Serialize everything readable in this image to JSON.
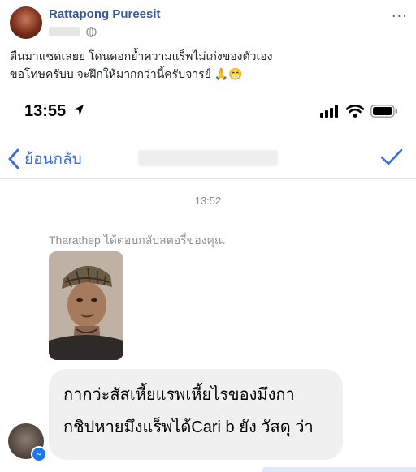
{
  "post": {
    "author": "Rattapong Pureesit",
    "more_glyph": "···",
    "caption_line1": "ตื่นมาแซดเลยย โดนดอกย้ำความแร็พไม่เก่งของตัวเอง",
    "caption_line2": "ขอโทษครับบ จะฝึกให้มากกว่านี้ครับจารย์ 🙏😁"
  },
  "phone": {
    "status_time": "13:55",
    "nav_back_label": "ย้อนกลับ",
    "timestamp": "13:52",
    "story_reply_note": "Tharathep ได้ตอบกลับสตอรี่ของคุณ",
    "message_line1": "กากว่ะสัสเหี้ยแรพเหี้ยไรของมึงกา",
    "message_line2": "กชิปหายมึงแร็พได้Cari b ยัง วัสดุ ว่า"
  },
  "colors": {
    "author_link": "#385898",
    "ios_blue": "#3b6ee0",
    "bubble_bg": "#f0f0f0",
    "messenger_blue": "#1877f2"
  },
  "icons": [
    "globe-icon",
    "more-icon",
    "location-arrow-icon",
    "signal-icon",
    "wifi-icon",
    "battery-icon",
    "chevron-left-icon",
    "checkmark-icon",
    "messenger-icon"
  ]
}
